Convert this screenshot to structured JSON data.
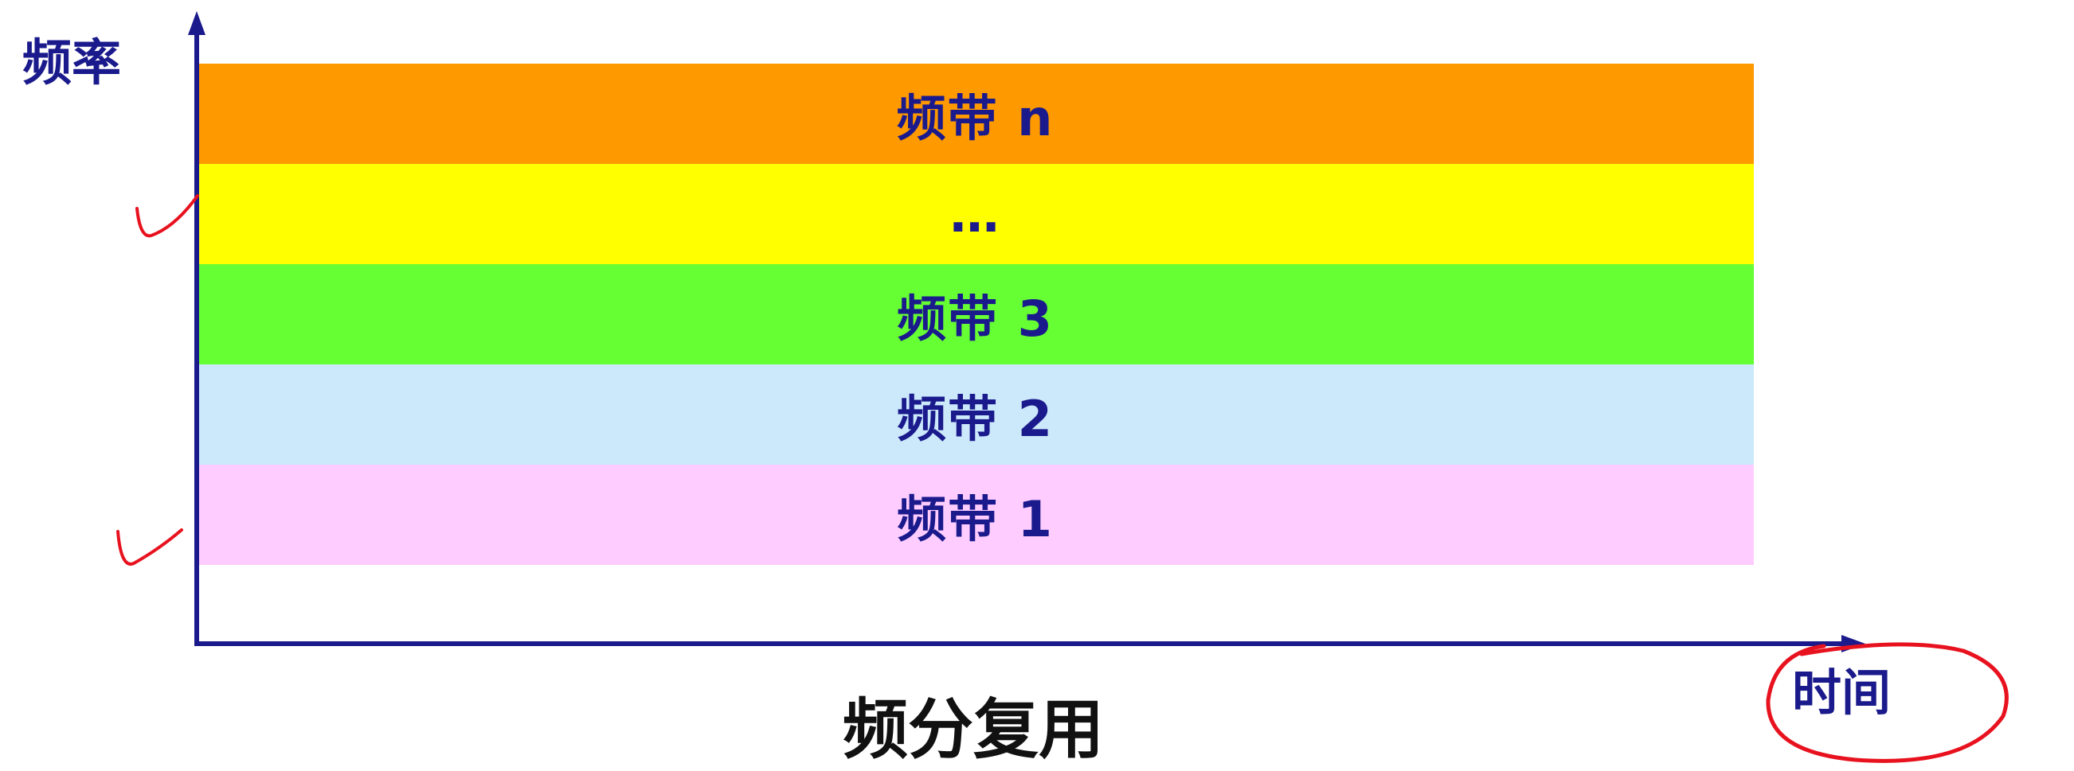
{
  "axes": {
    "y_label": "频率",
    "x_label": "时间"
  },
  "caption": "频分复用",
  "bands": [
    {
      "id": "band-n",
      "label": "频带 n",
      "color": "#ff9900"
    },
    {
      "id": "band-dots",
      "label": "…",
      "color": "#ffff00"
    },
    {
      "id": "band-3",
      "label": "频带 3",
      "color": "#66ff33"
    },
    {
      "id": "band-2",
      "label": "频带 2",
      "color": "#cce9fb"
    },
    {
      "id": "band-1",
      "label": "频带 1",
      "color": "#ffccff"
    }
  ],
  "colors": {
    "axis": "#1a1a8c",
    "text": "#1a1a8c",
    "annotation": "#e8121f"
  }
}
